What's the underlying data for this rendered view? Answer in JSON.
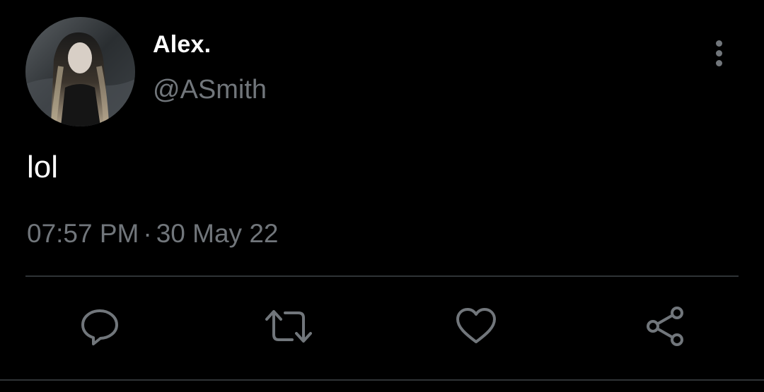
{
  "tweet": {
    "author": {
      "display_name": "Alex.",
      "handle": "@ASmith",
      "avatar_icon": "avatar-photo"
    },
    "text": "lol",
    "time": "07:57 PM",
    "separator": "·",
    "date": "30 May 22",
    "menu_icon": "more-vertical-icon"
  },
  "actions": [
    {
      "name": "reply",
      "icon": "reply-icon"
    },
    {
      "name": "retweet",
      "icon": "retweet-icon"
    },
    {
      "name": "like",
      "icon": "heart-icon"
    },
    {
      "name": "share",
      "icon": "share-icon"
    }
  ],
  "colors": {
    "background": "#000000",
    "primary_text": "#ffffff",
    "secondary_text": "#71767b",
    "divider": "#2f3336"
  }
}
